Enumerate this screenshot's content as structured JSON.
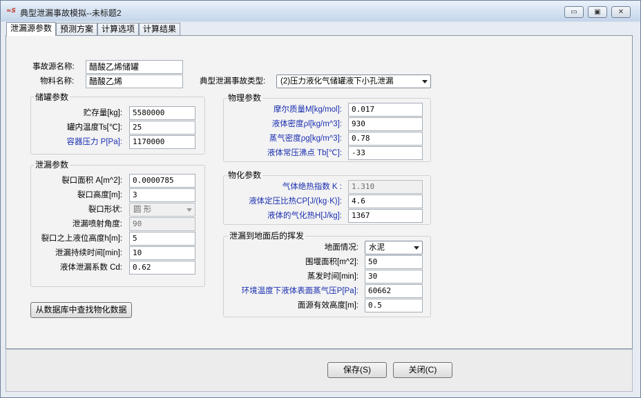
{
  "window": {
    "title": "典型泄漏事故模拟--未标题2",
    "app_icon": "app-logo-icon",
    "controls": {
      "minimize": "▭",
      "maximize": "▣",
      "close": "✕"
    }
  },
  "tabs": [
    "泄漏源参数",
    "预测方案",
    "计算选项",
    "计算结果"
  ],
  "source": {
    "name_label": "事故源名称:",
    "name_value": "醋酸乙烯储罐",
    "material_label": "物料名称:",
    "material_value": "醋酸乙烯",
    "accident_type_label": "典型泄漏事故类型:",
    "accident_type_value": "(2)压力液化气储罐液下小孔泄漏"
  },
  "storage": {
    "title": "储罐参数",
    "fields": [
      {
        "label": "贮存量[kg]:",
        "value": "5580000"
      },
      {
        "label": "罐内温度Ts[℃]:",
        "value": "25"
      },
      {
        "label": "容器压力 P[Pa]:",
        "value": "1170000"
      }
    ]
  },
  "leak": {
    "title": "泄漏参数",
    "area_label": "裂口面积 A[m^2]:",
    "area_value": "0.0000785",
    "height_label": "裂口高度[m]:",
    "height_value": "3",
    "shape_label": "裂口形状:",
    "shape_value": "圆  形",
    "angle_label": "泄漏喷射角度:",
    "angle_value": "90",
    "level_label": "裂口之上液位高度h[m]:",
    "level_value": "5",
    "duration_label": "泄漏持续时间[min]:",
    "duration_value": "10",
    "coef_label": "液体泄漏系数  Cd:",
    "coef_value": "0.62"
  },
  "physical": {
    "title": "物理参数",
    "fields": [
      {
        "label": "摩尔质量M[kg/mol]:",
        "value": "0.017"
      },
      {
        "label": "液体密度ρl[kg/m^3]:",
        "value": "930"
      },
      {
        "label": "蒸气密度ρg[kg/m^3]:",
        "value": "0.78"
      },
      {
        "label": "液体常压沸点 Tb[℃]:",
        "value": "-33"
      }
    ]
  },
  "chemical": {
    "title": "物化参数",
    "fields": [
      {
        "label": "气体绝热指数 K :",
        "value": "1.310"
      },
      {
        "label": "液体定压比热CP[J/(kg·K)]:",
        "value": "4.6"
      },
      {
        "label": "液体的气化热H[J/kg]:",
        "value": "1367"
      }
    ]
  },
  "evaporation": {
    "title": "泄漏到地面后的挥发",
    "ground_label": "地面情况:",
    "ground_value": "水泥",
    "area_label": "围堰面积[m^2]:",
    "area_value": "50",
    "time_label": "蒸发时间[min]:",
    "time_value": "30",
    "pressure_label": "环境温度下液体表面蒸气压P[Pa]:",
    "pressure_value": "60662",
    "height_label": "面源有效高度[m]:",
    "height_value": "0.5"
  },
  "buttons": {
    "lookup": "从数据库中查找物化数据",
    "save": "保存(S)",
    "close": "关闭(C)"
  },
  "colors": {
    "blue_label": "#1a2fb0"
  }
}
